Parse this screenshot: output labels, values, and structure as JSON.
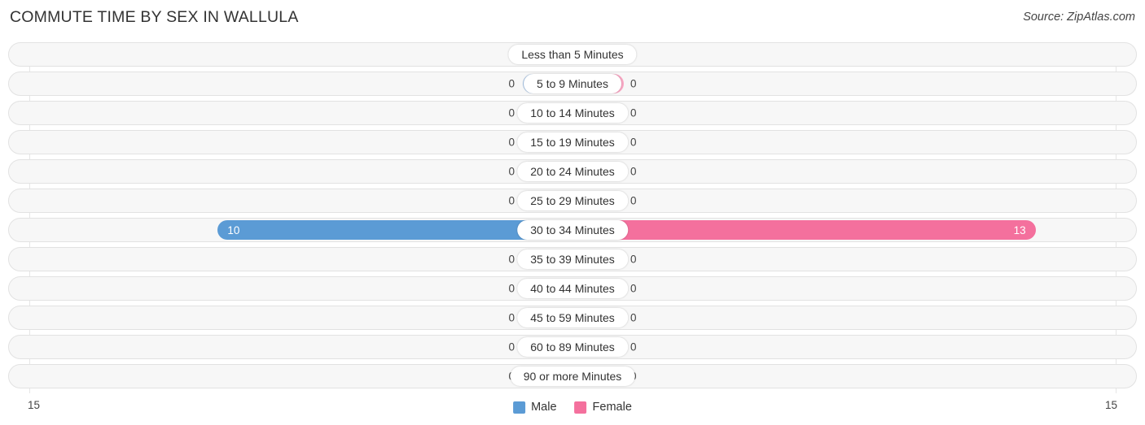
{
  "header": {
    "title": "COMMUTE TIME BY SEX IN WALLULA",
    "source": "Source: ZipAtlas.com"
  },
  "legend": {
    "male_label": "Male",
    "female_label": "Female"
  },
  "axis": {
    "left_label": "15",
    "right_label": "15"
  },
  "colors": {
    "male": "#5b9bd5",
    "female": "#f4709d",
    "male_zero": "#aac8ea",
    "female_zero": "#f9a8c4",
    "track": "#f7f7f7",
    "track_border": "#e2e2e2"
  },
  "chart_data": {
    "type": "bar",
    "title": "COMMUTE TIME BY SEX IN WALLULA",
    "subtitle": "Source: ZipAtlas.com",
    "orientation": "horizontal",
    "layout": "diverging-bidirectional",
    "xlabel": "",
    "ylabel": "",
    "xlim": [
      15,
      15
    ],
    "axis_max": 15,
    "grid": true,
    "legend_position": "bottom-center",
    "categories": [
      "Less than 5 Minutes",
      "5 to 9 Minutes",
      "10 to 14 Minutes",
      "15 to 19 Minutes",
      "20 to 24 Minutes",
      "25 to 29 Minutes",
      "30 to 34 Minutes",
      "35 to 39 Minutes",
      "40 to 44 Minutes",
      "45 to 59 Minutes",
      "60 to 89 Minutes",
      "90 or more Minutes"
    ],
    "series": [
      {
        "name": "Male",
        "color": "#5b9bd5",
        "direction": "left",
        "values": [
          0,
          0,
          0,
          0,
          0,
          0,
          10,
          0,
          0,
          0,
          0,
          0
        ],
        "labels": [
          "0",
          "0",
          "0",
          "0",
          "0",
          "0",
          "10",
          "0",
          "0",
          "0",
          "0",
          "0"
        ]
      },
      {
        "name": "Female",
        "color": "#f4709d",
        "direction": "right",
        "values": [
          0,
          0,
          0,
          0,
          0,
          0,
          13,
          0,
          0,
          0,
          0,
          0
        ],
        "labels": [
          "0",
          "0",
          "0",
          "0",
          "0",
          "0",
          "13",
          "0",
          "0",
          "0",
          "0",
          "0"
        ]
      }
    ]
  }
}
